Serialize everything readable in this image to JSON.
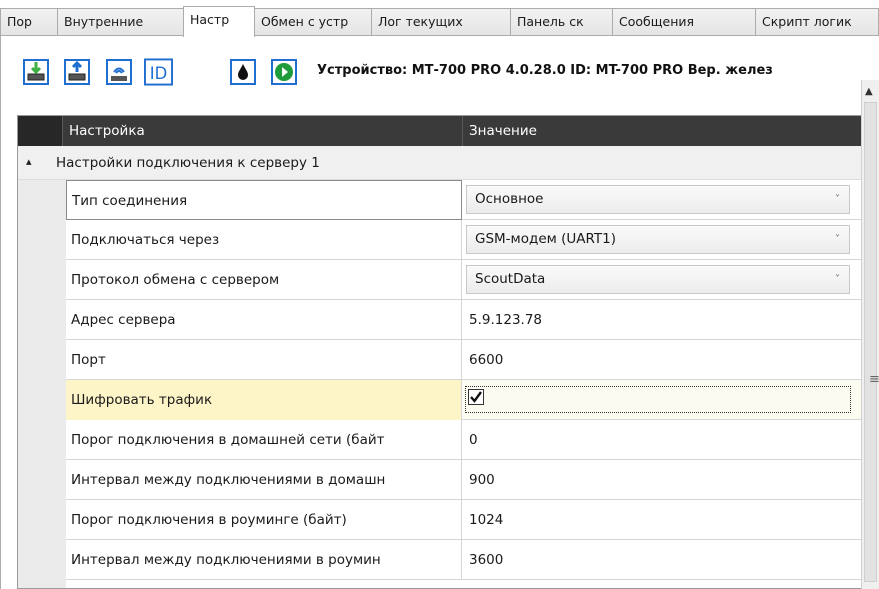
{
  "tabs": [
    {
      "label": "Пор",
      "active": false
    },
    {
      "label": "Внутренние",
      "active": false
    },
    {
      "label": "Настр",
      "active": true
    },
    {
      "label": "Обмен с устр",
      "active": false
    },
    {
      "label": "Лог текущих",
      "active": false
    },
    {
      "label": "Панель ск",
      "active": false
    },
    {
      "label": "Сообщения",
      "active": false
    },
    {
      "label": "Скрипт логик",
      "active": false
    }
  ],
  "toolbar": {
    "buttons": [
      {
        "icon": "download-to-device-icon"
      },
      {
        "icon": "upload-from-device-icon"
      },
      {
        "icon": "device-connect-icon"
      },
      {
        "icon": "id-icon",
        "text": "ID"
      },
      {
        "icon": "drop-icon"
      },
      {
        "icon": "play-icon"
      }
    ],
    "device_info": "Устройство: МТ-700 PRO 4.0.28.0 ID: MT-700 PRO Вер. желез"
  },
  "grid": {
    "columns": [
      "Настройка",
      "Значение"
    ],
    "group_label": "Настройки подключения к серверу 1",
    "rows": [
      {
        "name": "Тип соединения",
        "value": "Основное",
        "type": "combo"
      },
      {
        "name": "Подключаться через",
        "value": "GSM-модем (UART1)",
        "type": "combo"
      },
      {
        "name": "Протокол обмена с сервером",
        "value": "ScoutData",
        "type": "combo"
      },
      {
        "name": "Адрес сервера",
        "value": "5.9.123.78",
        "type": "text"
      },
      {
        "name": "Порт",
        "value": "6600",
        "type": "text"
      },
      {
        "name": "Шифровать трафик",
        "value": "",
        "type": "checkbox",
        "checked": true
      },
      {
        "name": "Порог подключения в домашней сети (байт",
        "value": "0",
        "type": "text"
      },
      {
        "name": "Интервал между подключениями в домашн",
        "value": "900",
        "type": "text"
      },
      {
        "name": "Порог подключения в роуминге (байт)",
        "value": "1024",
        "type": "text"
      },
      {
        "name": "Интервал между подключениями в роумин",
        "value": "3600",
        "type": "text"
      }
    ]
  },
  "colors": {
    "header_bg": "#3a3a3a",
    "selected_row": "#fdf5c8",
    "play_green": "#1e9c3c",
    "icon_blue": "#1f6fd1"
  }
}
